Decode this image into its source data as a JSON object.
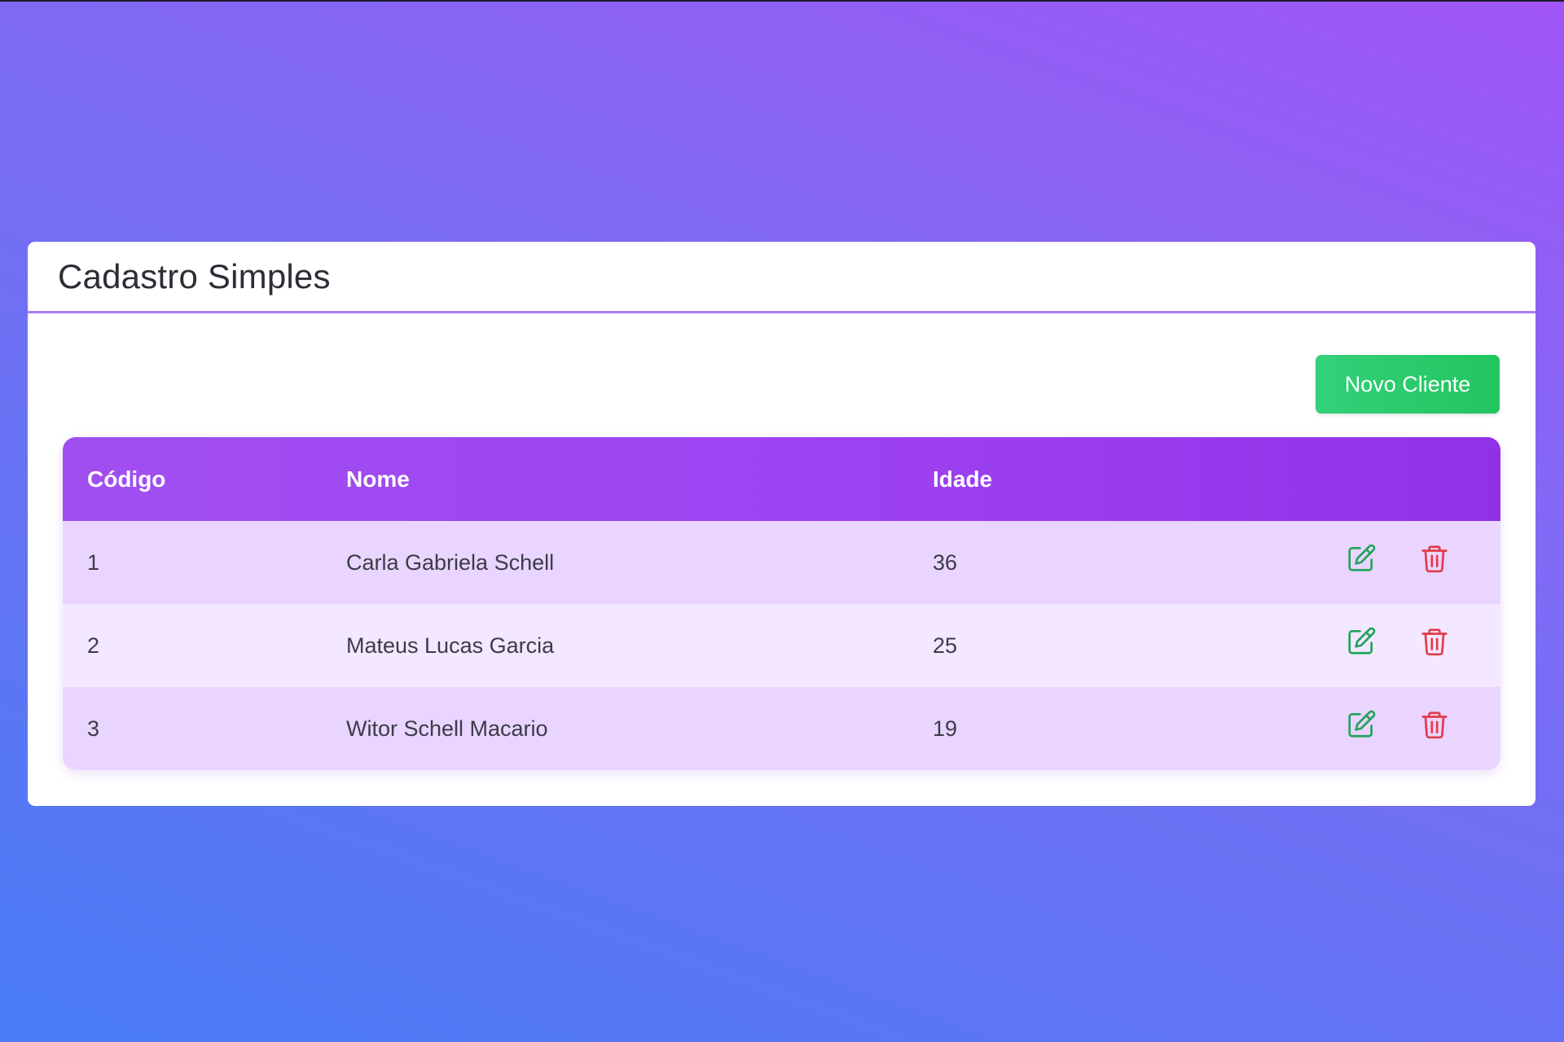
{
  "page": {
    "title": "Cadastro Simples"
  },
  "toolbar": {
    "new_label": "Novo Cliente"
  },
  "table": {
    "columns": [
      "Código",
      "Nome",
      "Idade",
      ""
    ],
    "rows": [
      {
        "codigo": "1",
        "nome": "Carla Gabriela Schell",
        "idade": "36"
      },
      {
        "codigo": "2",
        "nome": "Mateus Lucas Garcia",
        "idade": "25"
      },
      {
        "codigo": "3",
        "nome": "Witor Schell Macario",
        "idade": "19"
      }
    ]
  },
  "icons": {
    "edit": "edit-icon",
    "delete": "trash-icon"
  },
  "colors": {
    "accent": "#9d42f2",
    "success": "#22c55e",
    "edit": "#22a35a",
    "delete": "#e23b4a",
    "row_odd": "#e9d5ff",
    "row_even": "#f3e8ff"
  }
}
